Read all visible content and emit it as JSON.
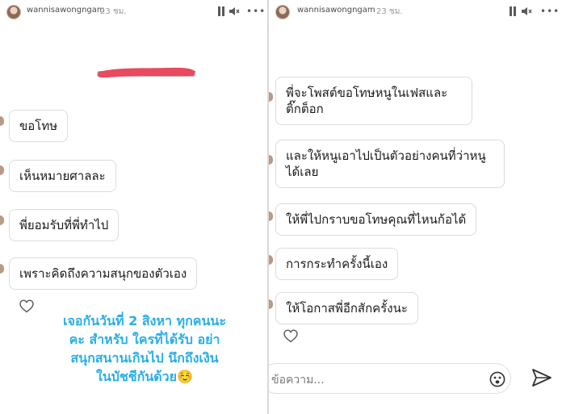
{
  "story_left": {
    "header": {
      "username": "wannisawongngam",
      "time": "23 ชม."
    },
    "messages": [
      "ขอโทษ",
      "เห็นหมายศาลละ",
      "พี่ยอมรับที่พี่ทำไป",
      "เพราะคิดถึงความสนุกของตัวเอง"
    ],
    "caption_lines": [
      "เจอกันวันที่ 2 สิงหา ทุกคนนะ",
      "คะ สำหรับ ใครที่ได้รับ อย่า",
      "สนุกสนานเกินไป นึกถึงเงิน",
      "ในบัชชีกันด้วย☺️"
    ]
  },
  "story_right": {
    "header": {
      "username": "wannisawongngam",
      "time": "23 ชม."
    },
    "messages": [
      "พี่จะโพสต์ขอโทษหนูในเฟสและติ๊กต็อก",
      "และให้หนูเอาไปเป็นตัวอย่างคนที่ว่าหนูได้เลย",
      "ให้พี่ไปกราบขอโทษคุณที่ไหนก้อได้",
      "การกระทำครั้งนี้เอง",
      "ให้โอกาสพี่อีกสักครั้งนะ"
    ],
    "compose": {
      "placeholder": "ข้อความ..."
    }
  },
  "colors": {
    "caption": "#29aee8",
    "redaction": "#e84a5f",
    "bubble_border": "#dcdcdc"
  },
  "icons": [
    "pause-icon",
    "speaker-icon",
    "more-icon",
    "heart-icon",
    "emoji-icon",
    "send-icon"
  ]
}
